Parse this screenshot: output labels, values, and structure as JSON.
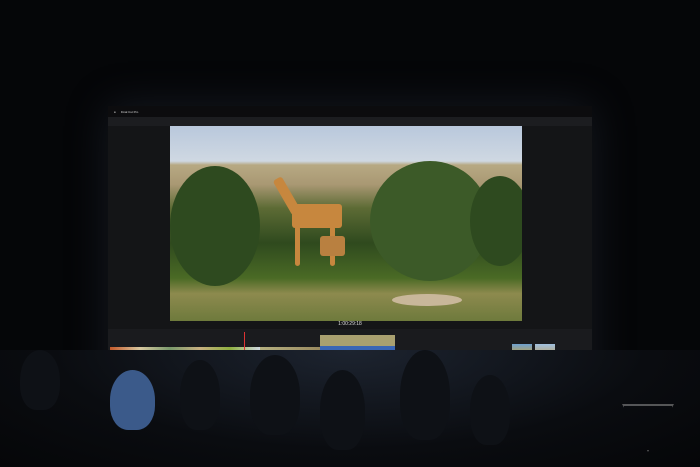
{
  "app": {
    "name": "Final Cut Pro"
  },
  "viewer": {
    "timecode": "1:00:29:18"
  },
  "colors": {
    "clip_blue": "#3a66b5",
    "playhead": "#dd3333",
    "menubar": "#0c0c0e"
  }
}
